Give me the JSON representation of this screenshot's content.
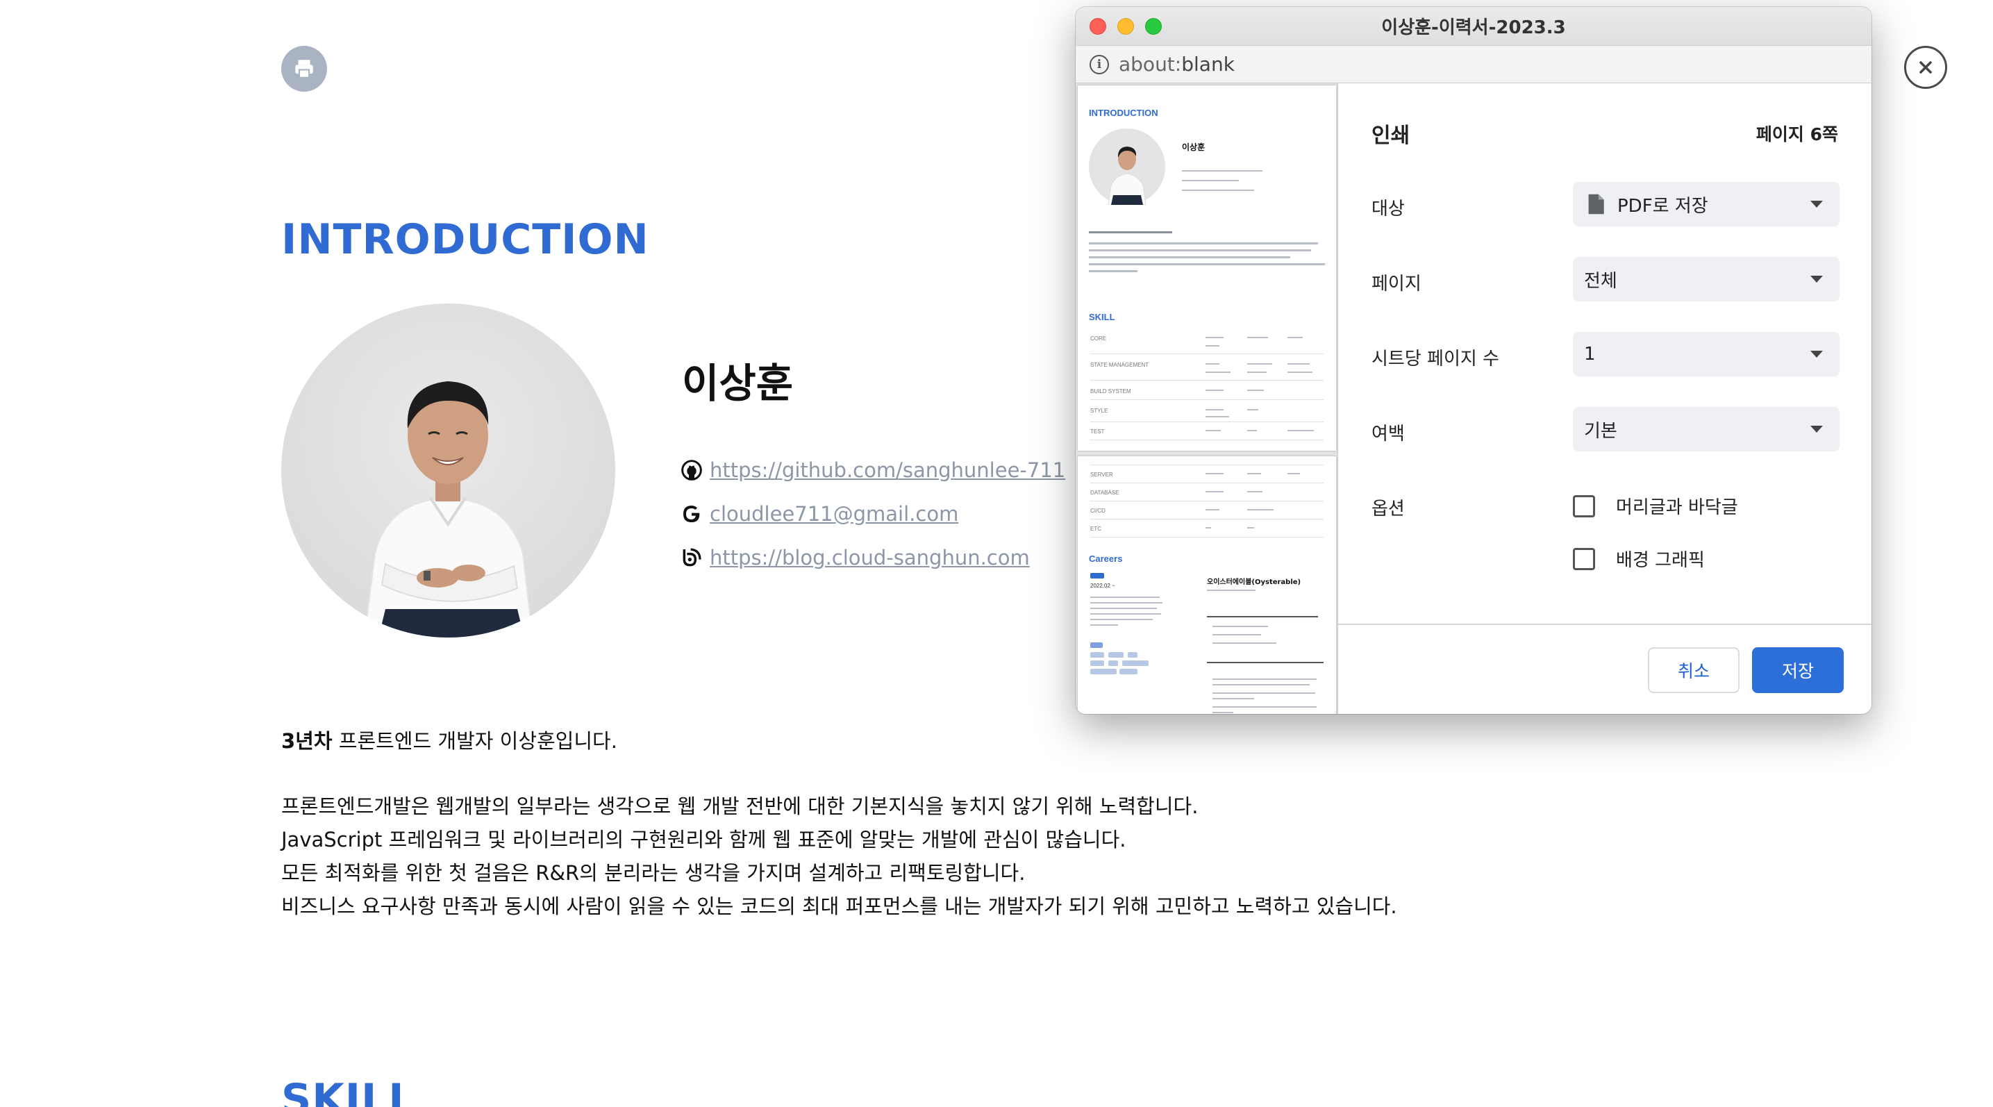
{
  "resume": {
    "intro_title": "INTRODUCTION",
    "skill_title": "SKILL",
    "name": "이상훈",
    "links": [
      {
        "icon": "github-icon",
        "text": "https://github.com/sanghunlee-711"
      },
      {
        "icon": "google-icon",
        "text": "cloudlee711@gmail.com"
      },
      {
        "icon": "blog-icon",
        "text": "https://blog.cloud-sanghun.com"
      }
    ],
    "intro_lead_bold": "3년차",
    "intro_lead_rest": " 프론트엔드 개발자 이상훈입니다.",
    "intro_lines": [
      "프론트엔드개발은 웹개발의 일부라는 생각으로 웹 개발 전반에 대한 기본지식을 놓치지 않기 위해 노력합니다.",
      "JavaScript 프레임워크 및 라이브러리의 구현원리와 함께 웹 표준에 알맞는 개발에 관심이 많습니다.",
      "모든 최적화를 위한 첫 걸음은 R&R의 분리라는 생각을 가지며 설계하고 리팩토링합니다.",
      "비즈니스 요구사항 만족과 동시에 사람이 읽을 수 있는 코드의 최대 퍼포먼스를 내는 개발자가 되기 위해 고민하고 노력하고 있습니다."
    ]
  },
  "dialog": {
    "window_title": "이상훈-이력서-2023.3",
    "url_scheme": "about:",
    "url_rest": "blank",
    "header": "인쇄",
    "page_count": "페이지 6쪽",
    "rows": {
      "destination_label": "대상",
      "destination_value": "PDF로 저장",
      "pages_label": "페이지",
      "pages_value": "전체",
      "per_sheet_label": "시트당 페이지 수",
      "per_sheet_value": "1",
      "margins_label": "여백",
      "margins_value": "기본",
      "options_label": "옵션",
      "option_headers": "머리글과 바닥글",
      "option_background": "배경 그래픽"
    },
    "cancel_label": "취소",
    "save_label": "저장"
  },
  "preview": {
    "page1": {
      "section_intro": "INTRODUCTION",
      "name": "이상훈",
      "section_skill": "SKILL",
      "skill_rows": [
        "CORE",
        "STATE MANAGEMENT",
        "BUILD SYSTEM",
        "STYLE",
        "TEST"
      ]
    },
    "page2": {
      "skill_rows": [
        "SERVER",
        "DATABASE",
        "CI/CD",
        "ETC"
      ],
      "section_careers": "Careers",
      "career_date": "2022.02 ~",
      "company": "오이스터에이블(Oysterable)"
    }
  },
  "colors": {
    "accent": "#2f6bd3",
    "save_button": "#2d6fd9",
    "link": "#8d96a6",
    "print_button": "#a9b3c2"
  }
}
